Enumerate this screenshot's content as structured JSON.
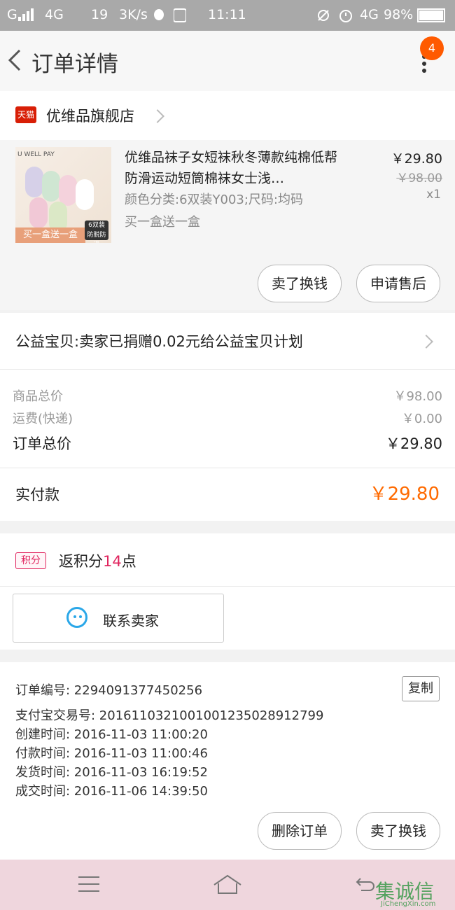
{
  "status_bar": {
    "carrier": "G",
    "network": "4G",
    "speed": "19",
    "speed_unit": "3K/s",
    "time": "11:11",
    "network_right": "4G",
    "battery": "98%"
  },
  "header": {
    "title": "订单详情",
    "badge_count": "4"
  },
  "shop": {
    "platform_badge": "天猫",
    "name": "优维品旗舰店"
  },
  "product": {
    "image_brand": "U WELL PAY",
    "image_ribbon": "买一盒送一盒",
    "image_tag": "6双装",
    "image_tag_sub": "防脱防滑",
    "title": "优维品袜子女短袜秋冬薄款纯棉低帮防滑运动短筒棉袜女士浅…",
    "sku": "颜色分类:6双装Y003;尺码:均码",
    "promo": "买一盒送一盒",
    "price": "￥29.80",
    "original_price": "￥98.00",
    "quantity": "x1"
  },
  "product_actions": {
    "sell_label": "卖了换钱",
    "after_sale_label": "申请售后"
  },
  "charity": {
    "text": "公益宝贝:卖家已捐赠0.02元给公益宝贝计划"
  },
  "totals": {
    "goods_label": "商品总价",
    "goods_value": "￥98.00",
    "shipping_label": "运费(快递)",
    "shipping_value": "￥0.00",
    "order_label": "订单总价",
    "order_value": "￥29.80"
  },
  "paid": {
    "label": "实付款",
    "value": "￥29.80"
  },
  "points": {
    "badge": "积分",
    "prefix": "返积分",
    "count": "14",
    "suffix": "点"
  },
  "contact": {
    "label": "联系卖家"
  },
  "order_info": {
    "order_no": "订单编号: 2294091377450256",
    "alipay_no": "支付宝交易号: 2016110321001001235028912799",
    "created": "创建时间: 2016-11-03  11:00:20",
    "paid": "付款时间: 2016-11-03  11:00:46",
    "shipped": "发货时间: 2016-11-03  16:19:52",
    "closed": "成交时间: 2016-11-06  14:39:50",
    "copy_label": "复制"
  },
  "bottom_actions": {
    "delete_label": "删除订单",
    "sell_label": "卖了换钱"
  },
  "watermark": {
    "text": "集诚信",
    "url_text": "JiChengXin.com"
  },
  "colors": {
    "accent_orange": "#ff6a00",
    "badge_orange": "#ff5a00",
    "points_pink": "#e0245e",
    "contact_blue": "#2aa7e8"
  }
}
